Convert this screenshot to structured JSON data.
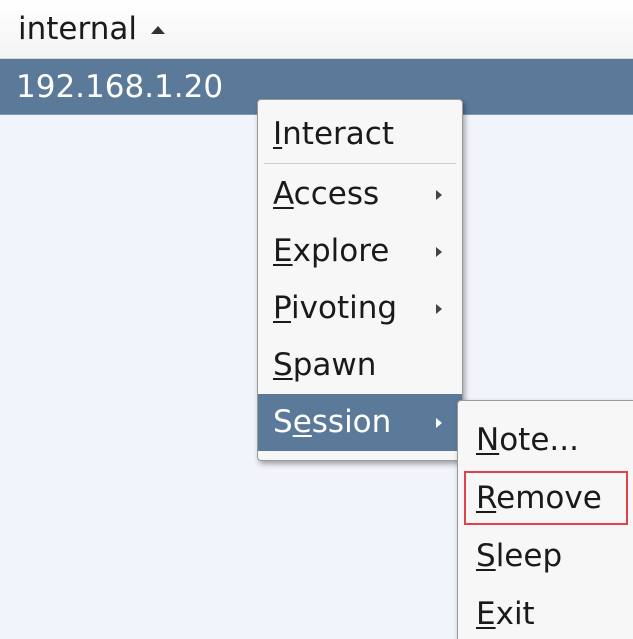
{
  "table": {
    "column_header": "internal",
    "sort_icon": "sort-ascending-icon",
    "selected_row": "192.168.1.20"
  },
  "context_menu": {
    "items": [
      {
        "pre": "",
        "key": "I",
        "rest": "nteract",
        "submenu": false
      },
      {
        "pre": "",
        "key": "A",
        "rest": "ccess",
        "submenu": true
      },
      {
        "pre": "",
        "key": "E",
        "rest": "xplore",
        "submenu": true
      },
      {
        "pre": "",
        "key": "P",
        "rest": "ivoting",
        "submenu": true
      },
      {
        "pre": "",
        "key": "S",
        "rest": "pawn",
        "submenu": false
      },
      {
        "pre": "S",
        "key": "e",
        "rest": "ssion",
        "submenu": true,
        "highlighted": true
      }
    ]
  },
  "session_submenu": {
    "items": [
      {
        "key": "N",
        "rest": "ote..."
      },
      {
        "key": "R",
        "rest": "emove",
        "framed": true
      },
      {
        "key": "S",
        "rest": "leep"
      },
      {
        "key": "E",
        "rest": "xit"
      }
    ]
  },
  "colors": {
    "selection": "#5b7a9a",
    "highlight_frame": "#e0444a"
  }
}
